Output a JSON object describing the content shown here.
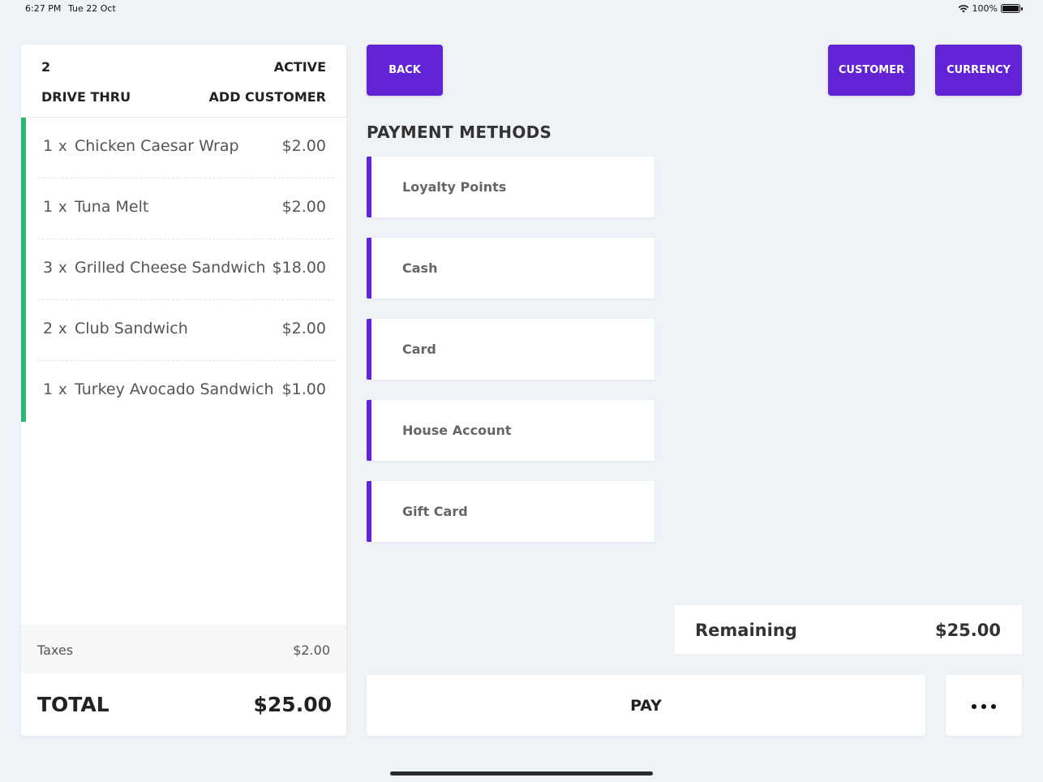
{
  "status_bar": {
    "time": "6:27 PM",
    "date": "Tue 22 Oct",
    "battery": "100%"
  },
  "order": {
    "number": "2",
    "status": "ACTIVE",
    "type": "DRIVE THRU",
    "add_customer": "ADD CUSTOMER",
    "items": [
      {
        "qty": "1",
        "x": "x",
        "name": "Chicken Caesar Wrap",
        "price": "$2.00"
      },
      {
        "qty": "1",
        "x": "x",
        "name": "Tuna Melt",
        "price": "$2.00"
      },
      {
        "qty": "3",
        "x": "x",
        "name": "Grilled Cheese Sandwich",
        "price": "$18.00"
      },
      {
        "qty": "2",
        "x": "x",
        "name": "Club Sandwich",
        "price": "$2.00"
      },
      {
        "qty": "1",
        "x": "x",
        "name": "Turkey Avocado Sandwich",
        "price": "$1.00"
      }
    ],
    "taxes_label": "Taxes",
    "taxes_value": "$2.00",
    "total_label": "TOTAL",
    "total_value": "$25.00"
  },
  "toolbar": {
    "back": "BACK",
    "customer": "CUSTOMER",
    "currency": "CURRENCY"
  },
  "payment": {
    "title": "PAYMENT METHODS",
    "methods": [
      "Loyalty Points",
      "Cash",
      "Card",
      "House Account",
      "Gift Card"
    ],
    "remaining_label": "Remaining",
    "remaining_value": "$25.00",
    "pay": "PAY"
  },
  "colors": {
    "accent": "#6123d4",
    "item_bar": "#2bb673",
    "background": "#eff2f6"
  }
}
